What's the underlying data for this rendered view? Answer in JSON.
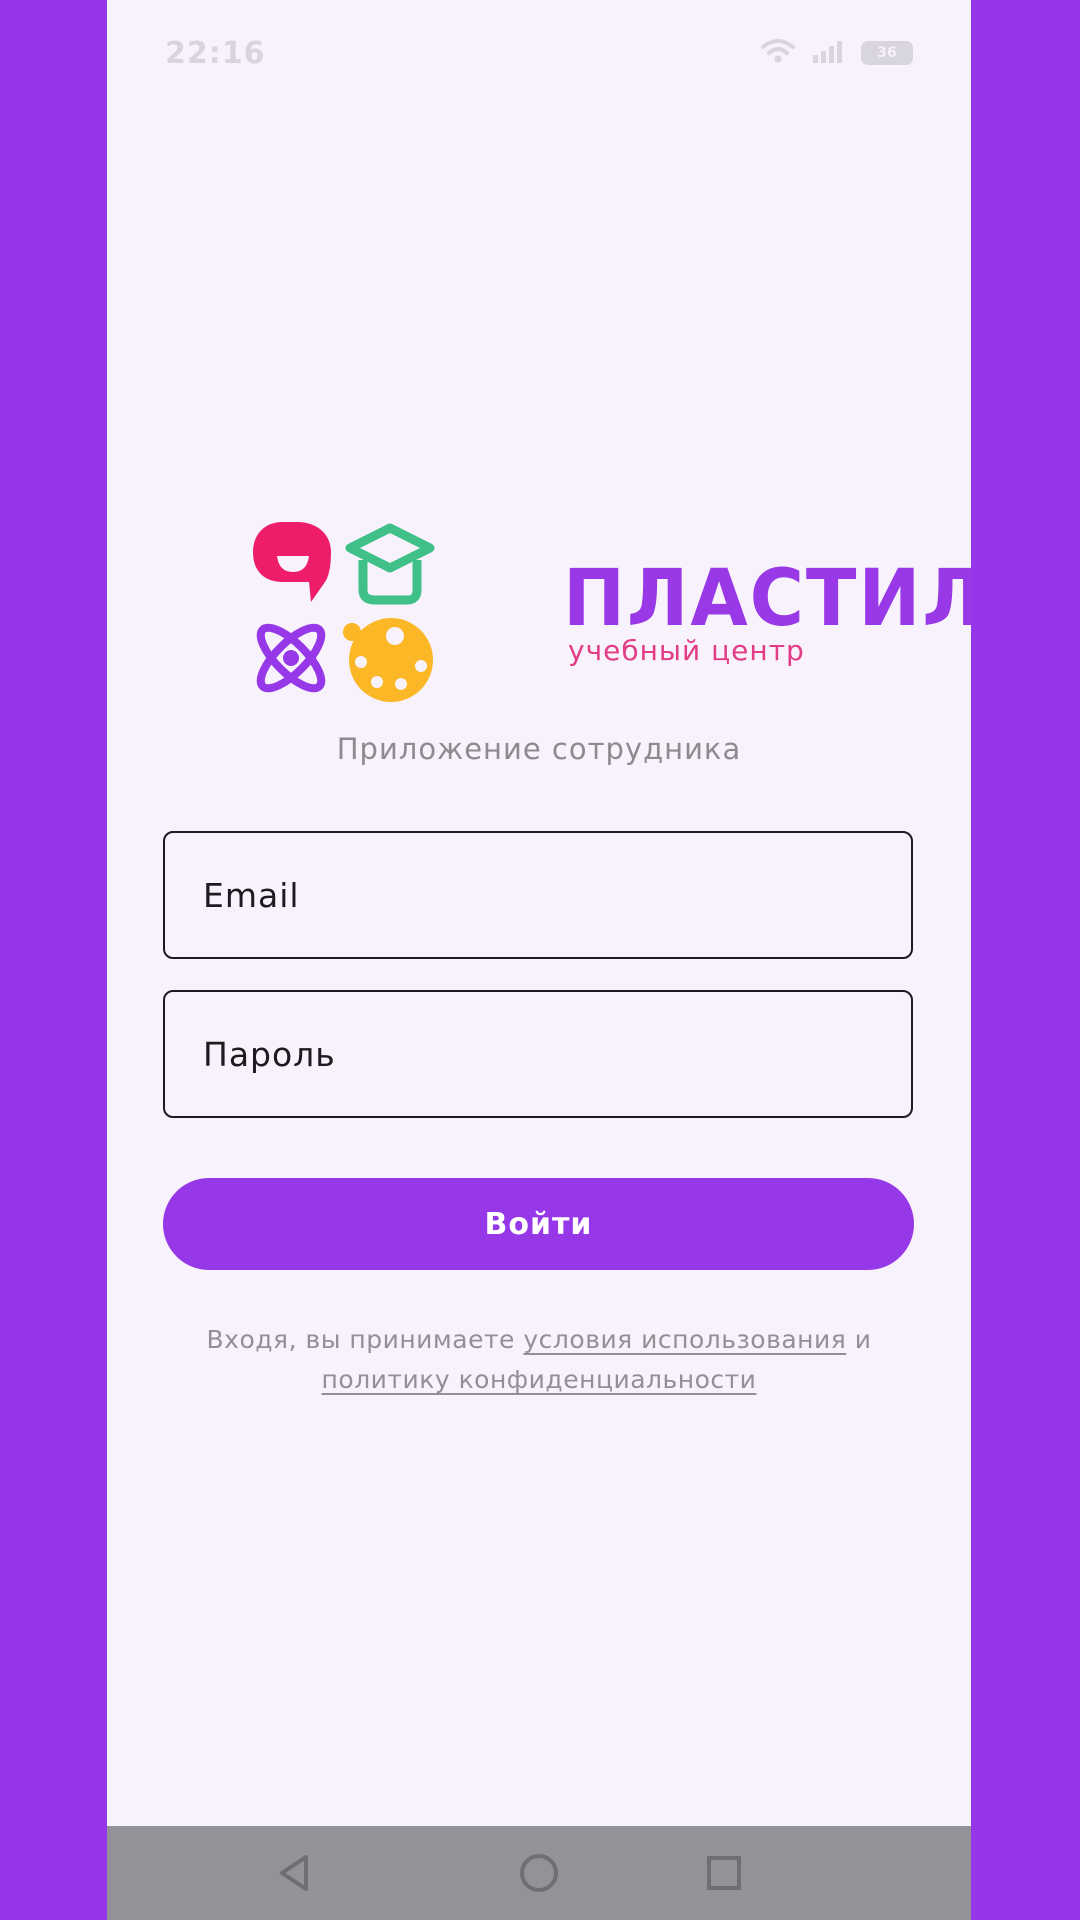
{
  "status_bar": {
    "time": "22:16",
    "battery": "36",
    "icons": [
      "wifi-icon",
      "signal-icon",
      "battery-icon"
    ]
  },
  "logo": {
    "name": "ПЛАСТИЛИН",
    "subtitle": "учебный центр",
    "icons": [
      "speech-bubble-icon",
      "graduation-cap-icon",
      "atom-icon",
      "palette-icon"
    ]
  },
  "app_subtitle": "Приложение сотрудника",
  "form": {
    "email_placeholder": "Email",
    "password_placeholder": "Пароль",
    "submit_label": "Войти"
  },
  "legal": {
    "prefix": "Входя, вы принимаете ",
    "terms_link": "условия использования",
    "connector": " и ",
    "privacy_link": "политику конфиденциальности"
  },
  "nav_bar": {
    "buttons": [
      "back-icon",
      "home-icon",
      "recents-icon"
    ]
  },
  "colors": {
    "background": "#9536ea",
    "screen": "#f7f2fb",
    "accent": "#9738e8",
    "brand_pink": "#e23d86",
    "logo_green": "#3fc089",
    "logo_yellow": "#fbb726"
  }
}
